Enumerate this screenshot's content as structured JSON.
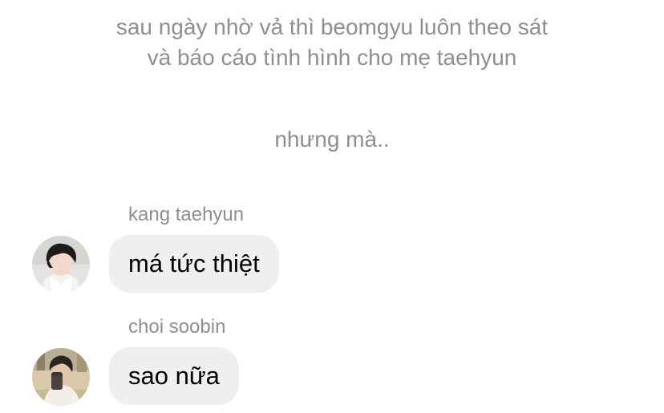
{
  "narration": {
    "line1": "sau ngày nhờ vả thì beomgyu luôn theo sát",
    "line2": "và báo cáo tình hình cho mẹ taehyun",
    "line3": "nhưng mà.."
  },
  "messages": [
    {
      "sender": "kang taehyun",
      "text": "má tức thiệt",
      "avatar_icon": "profile-photo"
    },
    {
      "sender": "choi soobin",
      "text": "sao nữa",
      "avatar_icon": "profile-photo"
    }
  ],
  "colors": {
    "background": "#ffffff",
    "narration_text": "#8e8e93",
    "sender_text": "#8e8e93",
    "bubble_bg": "#efeff1",
    "message_text": "#000000"
  }
}
